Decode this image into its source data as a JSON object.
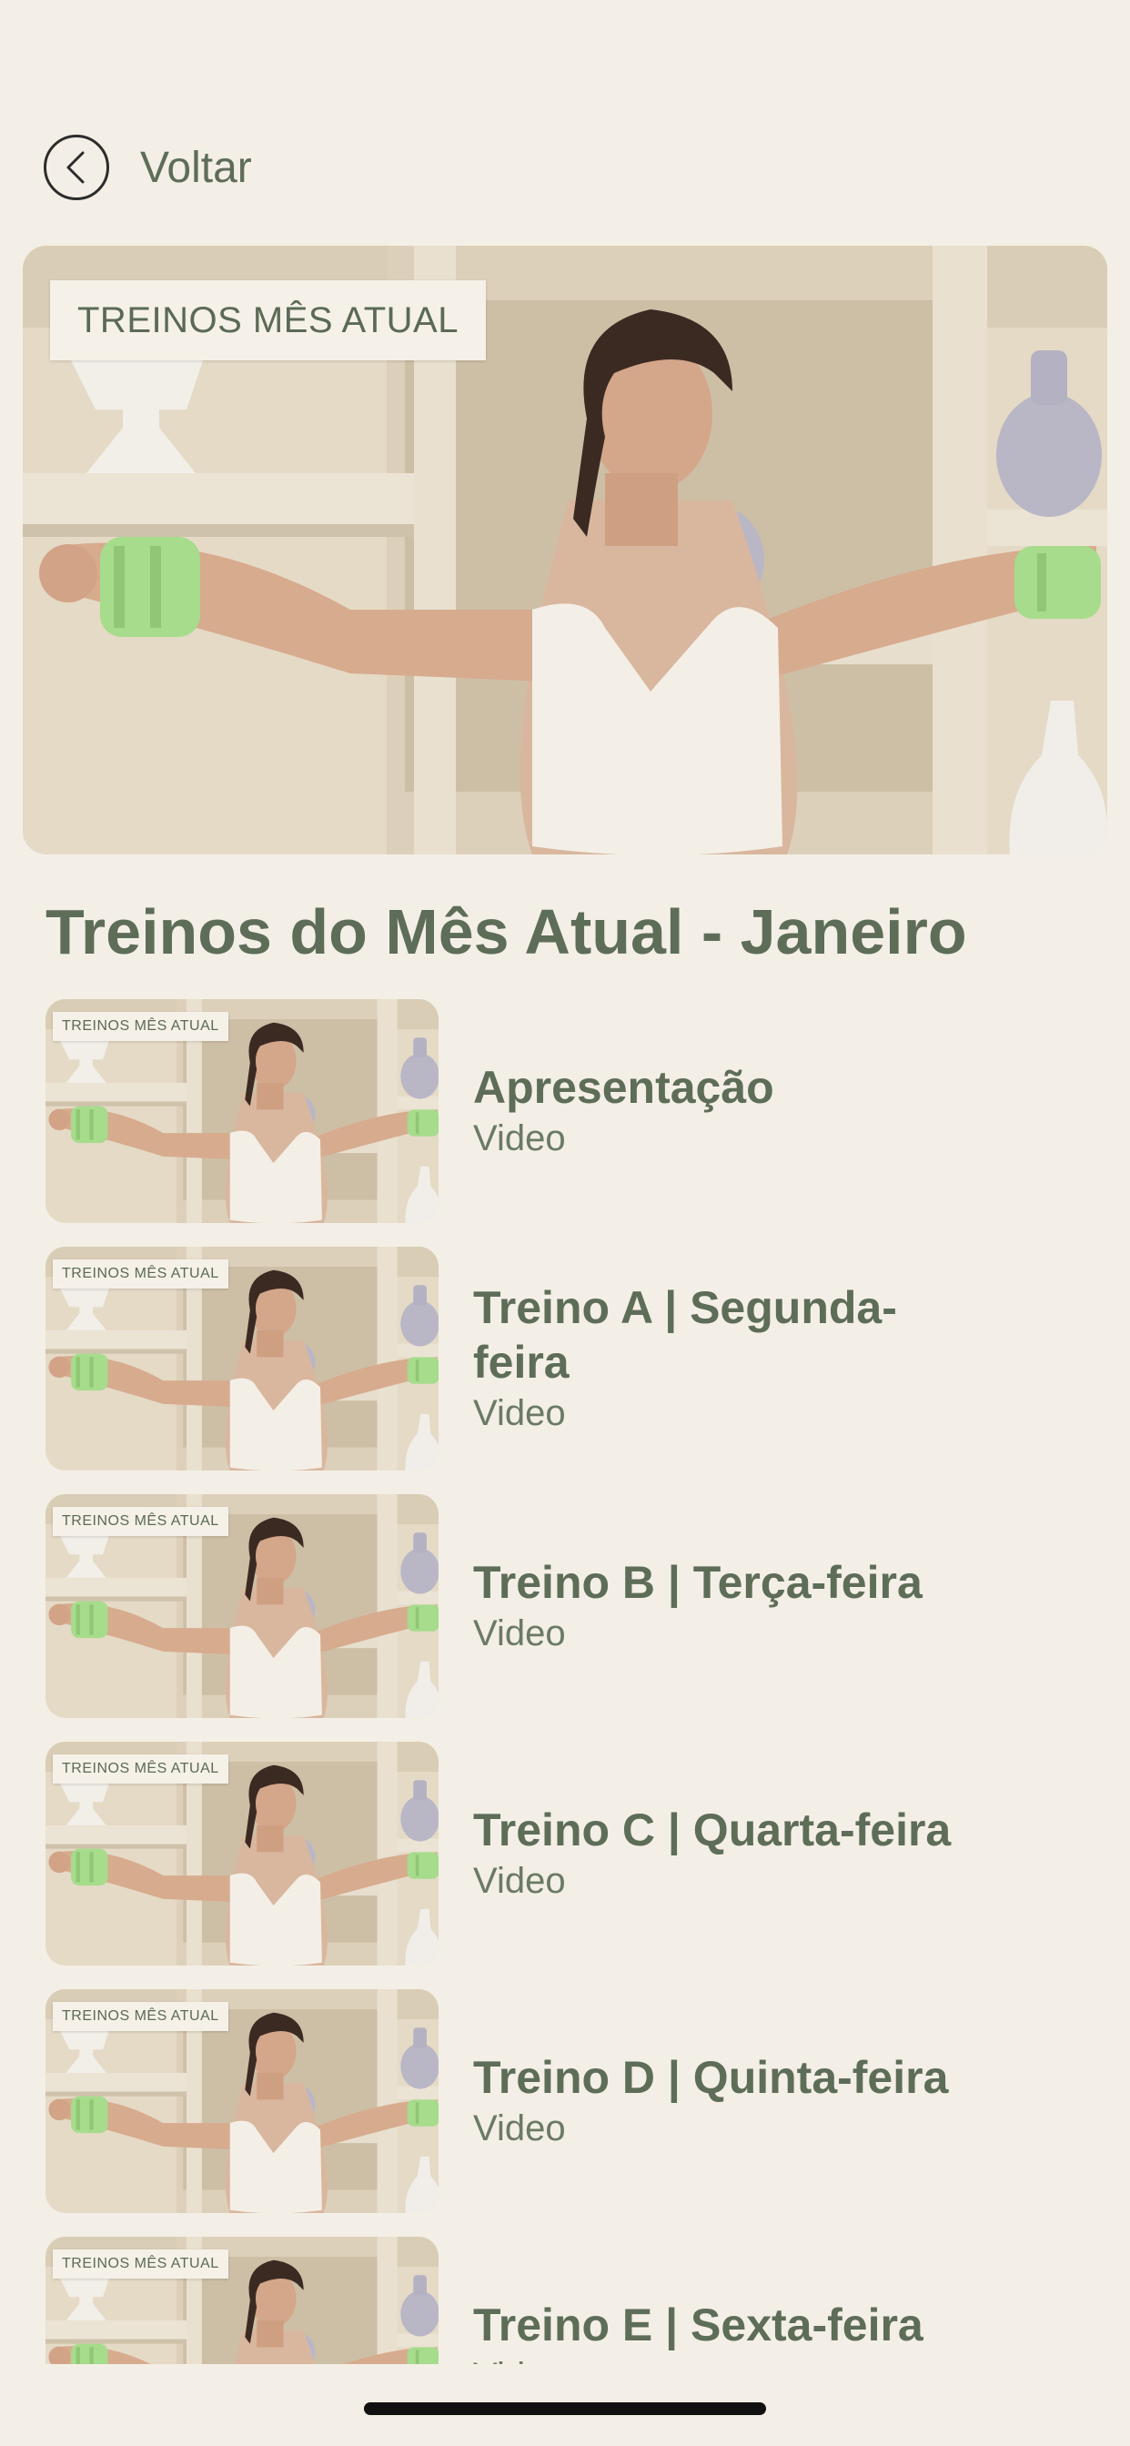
{
  "header": {
    "back_label": "Voltar"
  },
  "hero": {
    "tag_label": "TREINOS MÊS ATUAL"
  },
  "section": {
    "title": "Treinos do Mês Atual - Janeiro"
  },
  "workouts": [
    {
      "tag": "TREINOS MÊS ATUAL",
      "title": "Apresentação",
      "subtitle": "Video"
    },
    {
      "tag": "TREINOS MÊS ATUAL",
      "title": "Treino A | Segunda-feira",
      "subtitle": "Video"
    },
    {
      "tag": "TREINOS MÊS ATUAL",
      "title": "Treino B | Terça-feira",
      "subtitle": "Video"
    },
    {
      "tag": "TREINOS MÊS ATUAL",
      "title": "Treino C | Quarta-feira",
      "subtitle": "Video"
    },
    {
      "tag": "TREINOS MÊS ATUAL",
      "title": "Treino D | Quinta-feira",
      "subtitle": "Video"
    },
    {
      "tag": "TREINOS MÊS ATUAL",
      "title": "Treino E | Sexta-feira",
      "subtitle": "Video"
    }
  ],
  "icons": {
    "back": "chevron-left-icon"
  },
  "colors": {
    "background": "#f3efe6",
    "accent": "#5e6d58",
    "weights": "#a6dc8c"
  }
}
